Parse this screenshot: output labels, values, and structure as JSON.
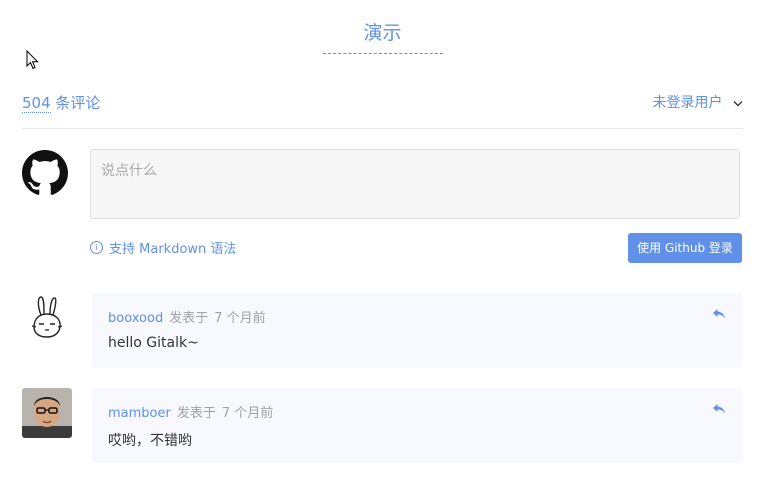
{
  "page": {
    "title": "演示"
  },
  "header": {
    "comment_count": "504",
    "comment_count_suffix": "条评论",
    "user_menu_label": "未登录用户"
  },
  "editor": {
    "placeholder": "说点什么",
    "markdown_tip": "支持 Markdown 语法",
    "login_button": "使用 Github 登录"
  },
  "comments": [
    {
      "author": "booxood",
      "posted_label": "发表于",
      "time": "7 个月前",
      "body": "hello Gitalk~"
    },
    {
      "author": "mamboer",
      "posted_label": "发表于",
      "time": "7 个月前",
      "body": "哎哟，不错哟"
    }
  ],
  "colors": {
    "accent": "#6190e8",
    "comment_bg": "#f7f9fe",
    "editor_bg": "#f6f6f6"
  }
}
